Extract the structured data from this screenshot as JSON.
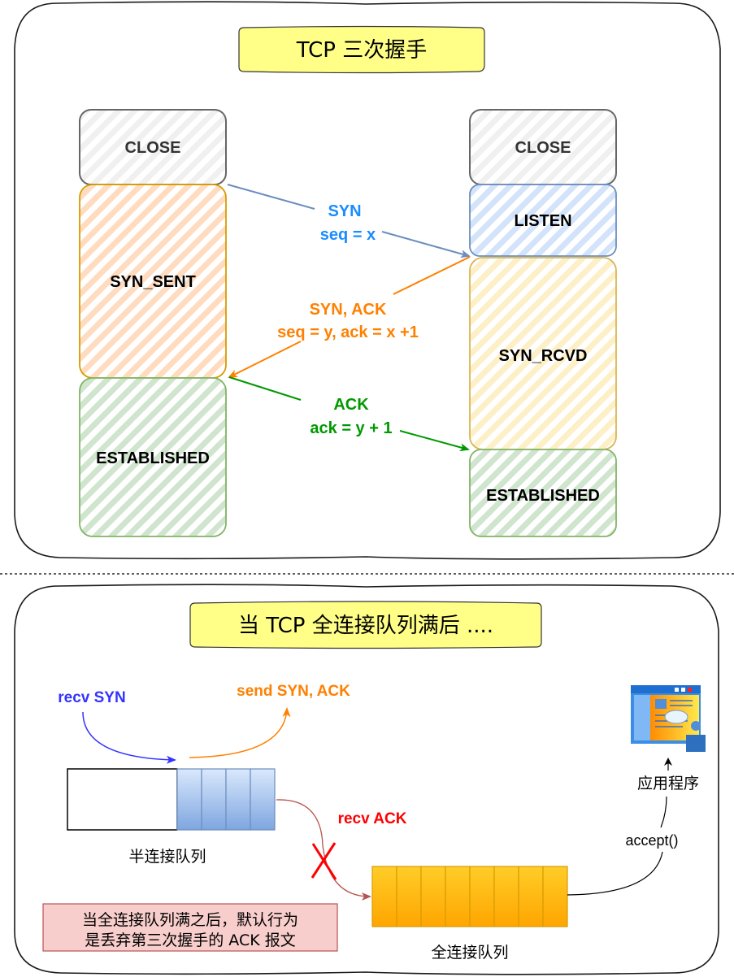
{
  "top_panel": {
    "title": "TCP 三次握手",
    "client_states": [
      {
        "label": "CLOSE",
        "kind": "close"
      },
      {
        "label": "SYN_SENT",
        "kind": "syn_sent"
      },
      {
        "label": "ESTABLISHED",
        "kind": "established"
      }
    ],
    "server_states": [
      {
        "label": "CLOSE",
        "kind": "close"
      },
      {
        "label": "LISTEN",
        "kind": "listen"
      },
      {
        "label": "SYN_RCVD",
        "kind": "syn_rcvd"
      },
      {
        "label": "ESTABLISHED",
        "kind": "established"
      }
    ],
    "messages": {
      "syn": {
        "line1": "SYN",
        "line2": "seq = x",
        "color": "#1a8cff"
      },
      "synack": {
        "line1": "SYN, ACK",
        "line2": "seq = y, ack = x +1",
        "color": "#ff8000"
      },
      "ack": {
        "line1": "ACK",
        "line2": "ack = y + 1",
        "color": "#009900"
      }
    }
  },
  "bottom_panel": {
    "title": "当 TCP 全连接队列满后 ....",
    "recv_syn": "recv SYN",
    "send_synack": "send SYN, ACK",
    "recv_ack": "recv ACK",
    "half_queue_label": "半连接队列",
    "full_queue_label": "全连接队列",
    "app_label": "应用程序",
    "accept_label": "accept()",
    "note_line1": "当全连接队列满之后，默认行为",
    "note_line2": "是丢弃第三次握手的 ACK 报文",
    "half_queue_filled_slots": 4,
    "full_queue_filled_slots": 8
  },
  "colors": {
    "close_stroke": "#666666",
    "close_fill": "#f5f5f5",
    "syn_sent_stroke": "#d79b00",
    "syn_sent_fill": "#ffe6cc",
    "established_stroke": "#82b366",
    "established_fill": "#d5e8d4",
    "listen_stroke": "#6c8ebf",
    "listen_fill": "#dae8fc",
    "syn_rcvd_stroke": "#d6b656",
    "syn_rcvd_fill": "#fff2cc",
    "title_fill": "#ffff88",
    "recv_syn": "#3333ff",
    "send_synack": "#ff8000",
    "recv_ack": "#ff0000",
    "note_fill": "#f8cecc",
    "note_stroke": "#b85450"
  }
}
